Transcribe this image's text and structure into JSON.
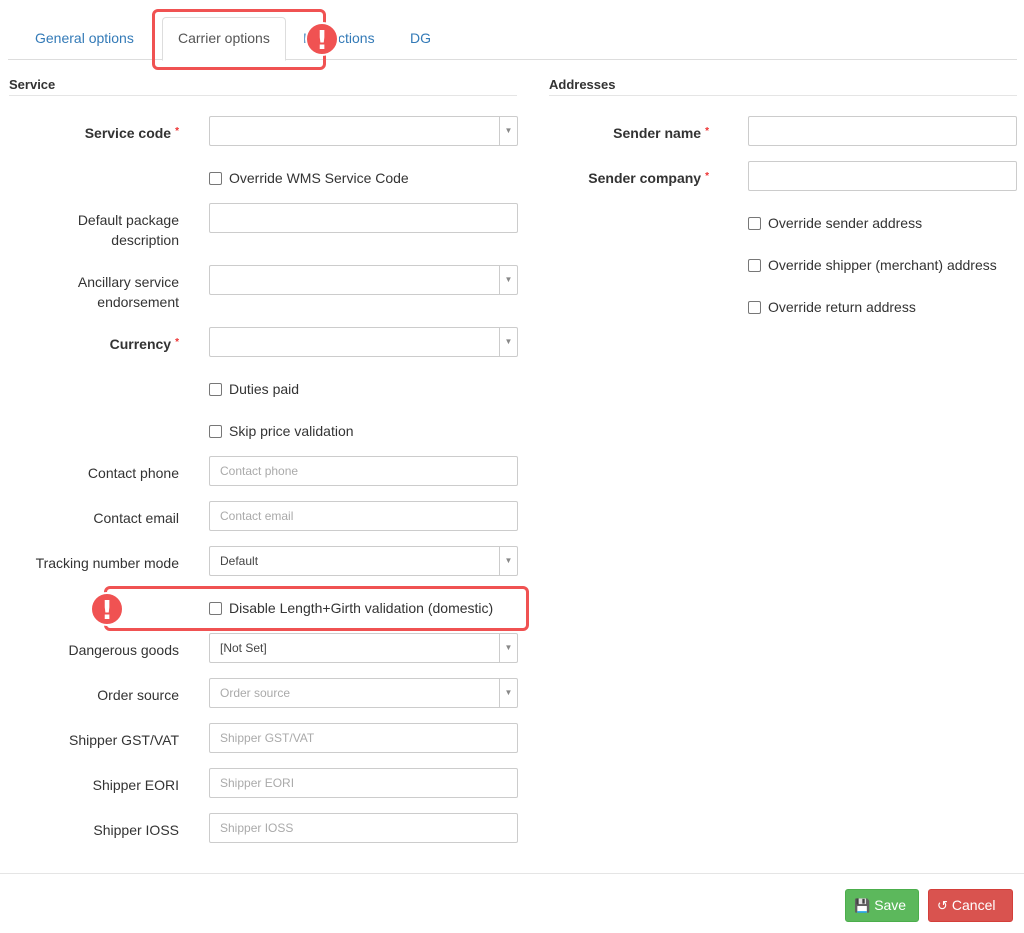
{
  "tabs": [
    {
      "label": "General options"
    },
    {
      "label": "Carrier options"
    },
    {
      "label": "Instructions"
    },
    {
      "label": "DG"
    }
  ],
  "service": {
    "title": "Service",
    "service_code_label": "Service code",
    "override_wms_label": "Override WMS Service Code",
    "default_package_label_line1": "Default package",
    "default_package_label_line2": "description",
    "ancillary_label_line1": "Ancillary service",
    "ancillary_label_line2": "endorsement",
    "currency_label": "Currency",
    "duties_paid_label": "Duties paid",
    "skip_price_label": "Skip price validation",
    "contact_phone_label": "Contact phone",
    "contact_phone_placeholder": "Contact phone",
    "contact_email_label": "Contact email",
    "contact_email_placeholder": "Contact email",
    "tracking_mode_label": "Tracking number mode",
    "tracking_mode_value": "Default",
    "disable_length_girth_label": "Disable Length+Girth validation (domestic)",
    "dangerous_goods_label": "Dangerous goods",
    "dangerous_goods_value": "[Not Set]",
    "order_source_label": "Order source",
    "order_source_placeholder": "Order source",
    "shipper_gst_label": "Shipper GST/VAT",
    "shipper_gst_placeholder": "Shipper GST/VAT",
    "shipper_eori_label": "Shipper EORI",
    "shipper_eori_placeholder": "Shipper EORI",
    "shipper_ioss_label": "Shipper IOSS",
    "shipper_ioss_placeholder": "Shipper IOSS"
  },
  "addresses": {
    "title": "Addresses",
    "sender_name_label": "Sender name",
    "sender_company_label": "Sender company",
    "override_sender_label": "Override sender address",
    "override_shipper_label": "Override shipper (merchant) address",
    "override_return_label": "Override return address"
  },
  "required_mark": "*",
  "annotation_mark": "!",
  "buttons": {
    "save_label": "Save",
    "cancel_label": "Cancel"
  },
  "colors": {
    "link": "#337ab7",
    "required": "#ee3333",
    "highlight": "#f05252",
    "save": "#5cb85c",
    "cancel": "#d9534f"
  }
}
